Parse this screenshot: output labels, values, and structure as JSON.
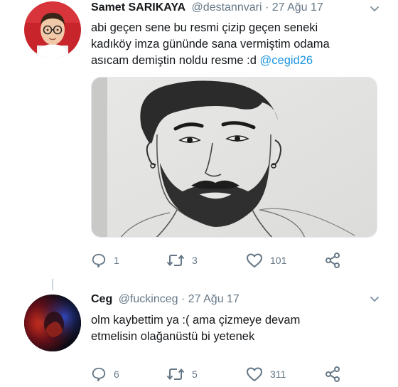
{
  "tweets": [
    {
      "author": {
        "name": "Samet SARIKAYA",
        "handle": "@destannvari",
        "time": "· 27 Ağu 17"
      },
      "text_lines": [
        "abi geçen sene bu resmi çizip geçen seneki",
        "kadıköy imza gününde sana vermiştim odama",
        "asıcam demiştin noldu resme :d"
      ],
      "mention": "@cegid26",
      "stats": {
        "replies": "1",
        "retweets": "3",
        "likes": "101"
      }
    },
    {
      "author": {
        "name": "Ceg",
        "handle": "@fuckinceg",
        "time": "· 27 Ağu 17"
      },
      "text_lines": [
        "olm kaybettim ya :( ama çizmeye devam",
        "etmelisin olağanüstü bi yetenek"
      ],
      "stats": {
        "replies": "6",
        "retweets": "5",
        "likes": "311"
      }
    }
  ],
  "icons": {
    "reply": "speech-bubble-icon",
    "retweet": "retweet-arrows-icon",
    "like": "heart-icon",
    "share": "share-nodes-icon",
    "more": "chevron-down-icon"
  },
  "colors": {
    "text": "#14171a",
    "secondary": "#657786",
    "mention": "#1b95e0",
    "icon": "#657786"
  }
}
